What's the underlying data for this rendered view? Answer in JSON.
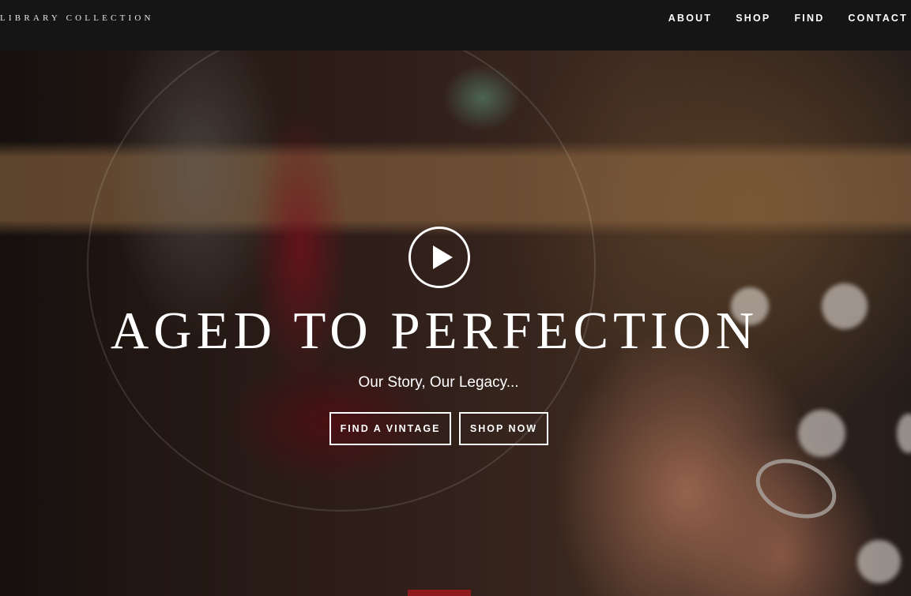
{
  "header": {
    "brand": "LIBRARY COLLECTION",
    "nav": [
      "ABOUT",
      "SHOP",
      "FIND",
      "CONTACT"
    ]
  },
  "hero": {
    "play_icon": "play-icon",
    "headline": "AGED TO PERFECTION",
    "tagline": "Our Story, Our Legacy...",
    "cta_find": "FIND A VINTAGE",
    "cta_shop": "SHOP NOW"
  },
  "colors": {
    "header_bg": "#151515",
    "text": "#ffffff",
    "accent": "#8e1a1e"
  }
}
